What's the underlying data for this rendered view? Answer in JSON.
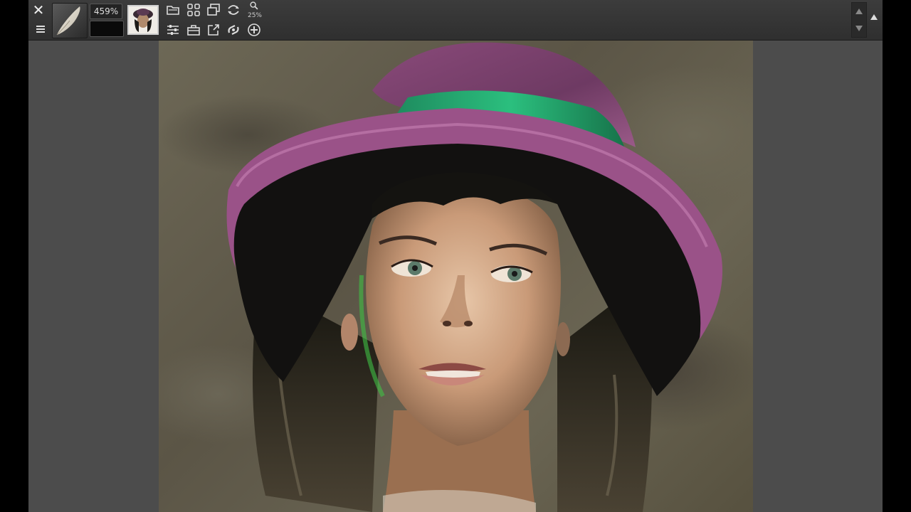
{
  "toolbar": {
    "close_icon": "close-icon",
    "menu_icon": "menu-icon",
    "zoom_percent": "459%",
    "zoom_step": "25%",
    "brush_icon": "brush-tip-icon",
    "current_color": "#0a0a0a"
  },
  "tools": [
    {
      "name": "open-file-icon"
    },
    {
      "name": "grid-icon"
    },
    {
      "name": "layers-icon"
    },
    {
      "name": "symmetry-icon"
    },
    {
      "name": "zoom-icon"
    },
    {
      "name": "adjust-sliders-icon"
    },
    {
      "name": "toolbox-icon"
    },
    {
      "name": "export-icon"
    },
    {
      "name": "transform-icon"
    },
    {
      "name": "add-icon"
    }
  ],
  "colors": {
    "toolbar_bg": "#333333",
    "workspace_bg": "#4c4c4c",
    "frame_bg": "#000000"
  }
}
